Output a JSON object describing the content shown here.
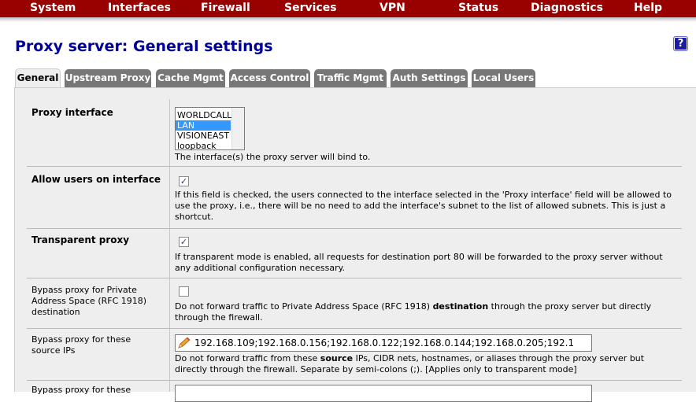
{
  "nav": {
    "items": [
      "System",
      "Interfaces",
      "Firewall",
      "Services",
      "VPN",
      "Status",
      "Diagnostics",
      "Help"
    ]
  },
  "page": {
    "title": "Proxy server: General settings",
    "help_icon": "?"
  },
  "tabs": [
    "General",
    "Upstream Proxy",
    "Cache Mgmt",
    "Access Control",
    "Traffic Mgmt",
    "Auth Settings",
    "Local Users"
  ],
  "active_tab": "General",
  "fields": {
    "proxy_interface": {
      "label": "Proxy interface",
      "options": [
        "WORLDCALL",
        "LAN",
        "VISIONEAST",
        "loopback"
      ],
      "selected": "LAN",
      "description": "The interface(s) the proxy server will bind to."
    },
    "allow_users": {
      "label": "Allow users on interface",
      "checked": true,
      "check_glyph": "✓",
      "description": "If this field is checked, the users connected to the interface selected in the 'Proxy interface' field will be allowed to use the proxy, i.e., there will be no need to add the interface's subnet to the list of allowed subnets. This is just a shortcut."
    },
    "transparent": {
      "label": "Transparent proxy",
      "checked": true,
      "check_glyph": "✓",
      "description": "If transparent mode is enabled, all requests for destination port 80 will be forwarded to the proxy server without any additional configuration necessary."
    },
    "bypass_private": {
      "label": "Bypass proxy for Private Address Space (RFC 1918) destination",
      "checked": false,
      "desc_pre": "Do not forward traffic to Private Address Space (RFC 1918) ",
      "desc_bold": "destination",
      "desc_post": " through the proxy server but directly through the firewall."
    },
    "bypass_source": {
      "label": "Bypass proxy for these source IPs",
      "value": "192.168.109;192.168.0.156;192.168.0.122;192.168.0.144;192.168.0.205;192.1",
      "desc_pre": "Do not forward traffic from these ",
      "desc_bold": "source",
      "desc_post": " IPs, CIDR nets, hostnames, or aliases through the proxy server but directly through the firewall. Separate by semi-colons (;). [Applies only to transparent mode]"
    },
    "bypass_dest": {
      "label": "Bypass proxy for these"
    }
  },
  "colors": {
    "nav_bg": "#990000",
    "title": "#000099",
    "tab_bg": "#777777",
    "panel_bg": "#eeeeee",
    "selection": "#3399ff"
  }
}
